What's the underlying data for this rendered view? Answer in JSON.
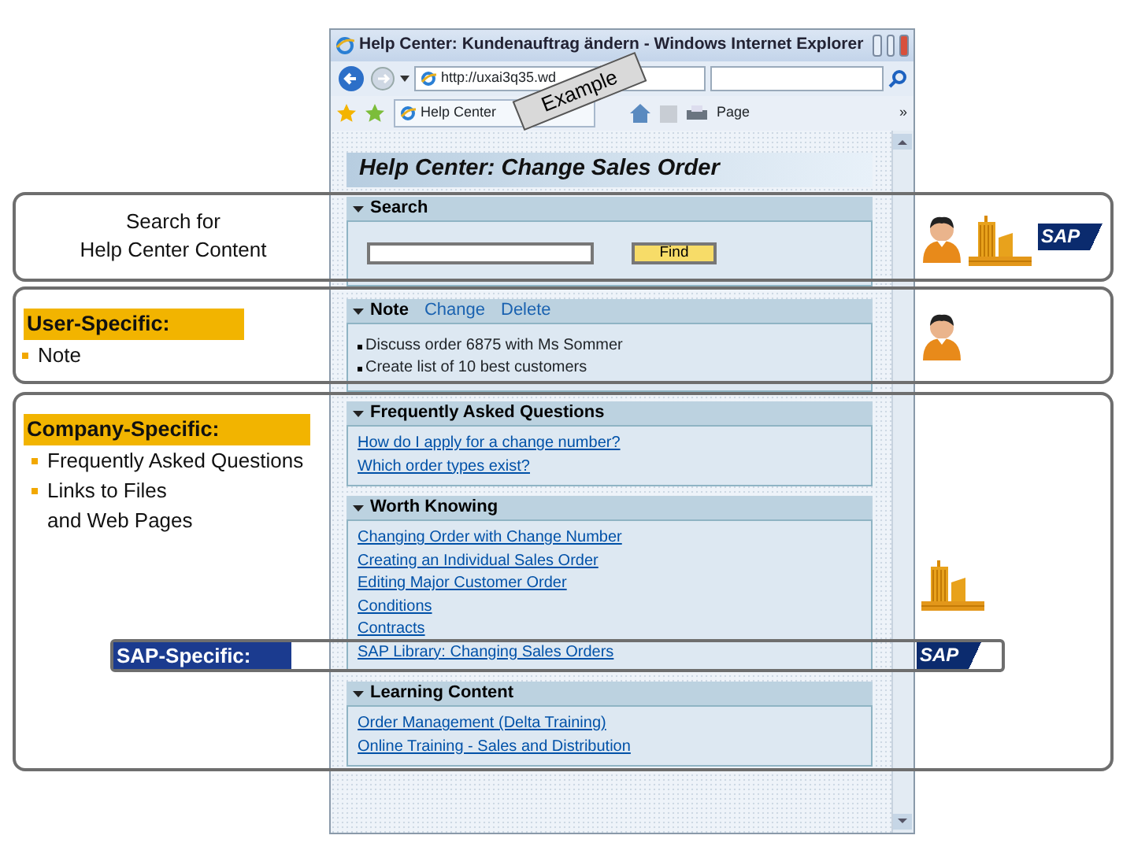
{
  "browser": {
    "title": "Help Center: Kundenauftrag ändern - Windows Internet Explorer",
    "address": "http://uxai3q35.wd",
    "tab": "Help Center",
    "page_menu": "Page",
    "chevron": "»"
  },
  "stamp": {
    "text": "Example"
  },
  "page": {
    "heading": "Help Center: Change Sales Order",
    "sections": [
      {
        "kind": "search",
        "title": "Search",
        "button": "Find"
      },
      {
        "kind": "note",
        "title": "Note",
        "actions": [
          "Change",
          "Delete"
        ],
        "items": [
          "Discuss order 6875 with Ms Sommer",
          "Create list of 10 best customers"
        ]
      },
      {
        "kind": "links",
        "title": "Frequently Asked Questions",
        "links": [
          "How do I apply for a change number?",
          "Which order types exist?"
        ]
      },
      {
        "kind": "links",
        "title": "Worth Knowing",
        "links": [
          "Changing Order with Change Number",
          "Creating an Individual Sales Order",
          "Editing Major Customer Order",
          "Conditions",
          "Contracts",
          "SAP Library: Changing Sales Orders"
        ]
      },
      {
        "kind": "links",
        "title": "Learning Content",
        "links": [
          "Order Management (Delta Training)",
          "Online Training - Sales and Distribution"
        ]
      }
    ]
  },
  "callouts": [
    {
      "kind": "plain",
      "text": "Search for\nHelp Center Content",
      "icons": [
        {
          "kind": "user"
        },
        {
          "kind": "company"
        },
        {
          "kind": "sap",
          "text": "SAP"
        }
      ]
    },
    {
      "kind": "list",
      "heading": "User-Specific:",
      "items": [
        "Note"
      ],
      "icons": [
        {
          "kind": "user"
        }
      ]
    },
    {
      "kind": "list",
      "heading": "Company-Specific:",
      "items": [
        "Frequently Asked Questions",
        "Links to Files\nand Web Pages"
      ],
      "icons": [
        {
          "kind": "company"
        }
      ]
    },
    {
      "kind": "band",
      "heading": "SAP-Specific:",
      "icons": [
        {
          "kind": "sap",
          "text": "SAP"
        }
      ]
    }
  ]
}
